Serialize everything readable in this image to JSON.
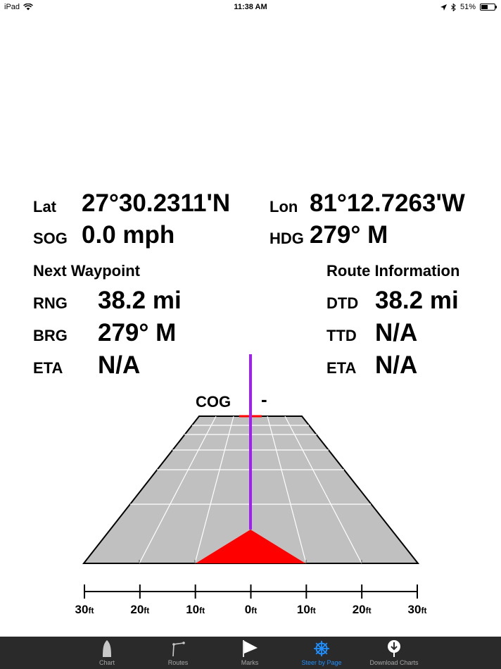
{
  "status_bar": {
    "device": "iPad",
    "time": "11:38 AM",
    "battery_text": "51%",
    "battery_level": 0.51
  },
  "position": {
    "lat_label": "Lat",
    "lat_value": "27°30.2311'N",
    "lon_label": "Lon",
    "lon_value": "81°12.7263'W",
    "sog_label": "SOG",
    "sog_value": "0.0 mph",
    "hdg_label": "HDG",
    "hdg_value": "279° M"
  },
  "next_waypoint": {
    "title": "Next Waypoint",
    "rng_label": "RNG",
    "rng_value": "38.2 mi",
    "brg_label": "BRG",
    "brg_value": "279° M",
    "eta_label": "ETA",
    "eta_value": "N/A"
  },
  "route_info": {
    "title": "Route Information",
    "dtd_label": "DTD",
    "dtd_value": "38.2 mi",
    "ttd_label": "TTD",
    "ttd_value": "N/A",
    "eta_label": "ETA",
    "eta_value": "N/A"
  },
  "steer": {
    "cog_label": "COG",
    "cog_value": "-",
    "scale": [
      {
        "num": "30",
        "unit": "ft"
      },
      {
        "num": "20",
        "unit": "ft"
      },
      {
        "num": "10",
        "unit": "ft"
      },
      {
        "num": "0",
        "unit": "ft"
      },
      {
        "num": "10",
        "unit": "ft"
      },
      {
        "num": "20",
        "unit": "ft"
      },
      {
        "num": "30",
        "unit": "ft"
      }
    ],
    "colors": {
      "lane_fill": "#c0c0c0",
      "course_line": "#a020f0",
      "boat": "#ff0000",
      "grid": "#ffffff"
    }
  },
  "tabs": [
    {
      "label": "Chart",
      "icon": "boat-icon",
      "active": false
    },
    {
      "label": "Routes",
      "icon": "route-icon",
      "active": false
    },
    {
      "label": "Marks",
      "icon": "flag-icon",
      "active": false
    },
    {
      "label": "Steer by Page",
      "icon": "helm-wheel-icon",
      "active": true
    },
    {
      "label": "Download Charts",
      "icon": "download-icon",
      "active": false
    }
  ]
}
